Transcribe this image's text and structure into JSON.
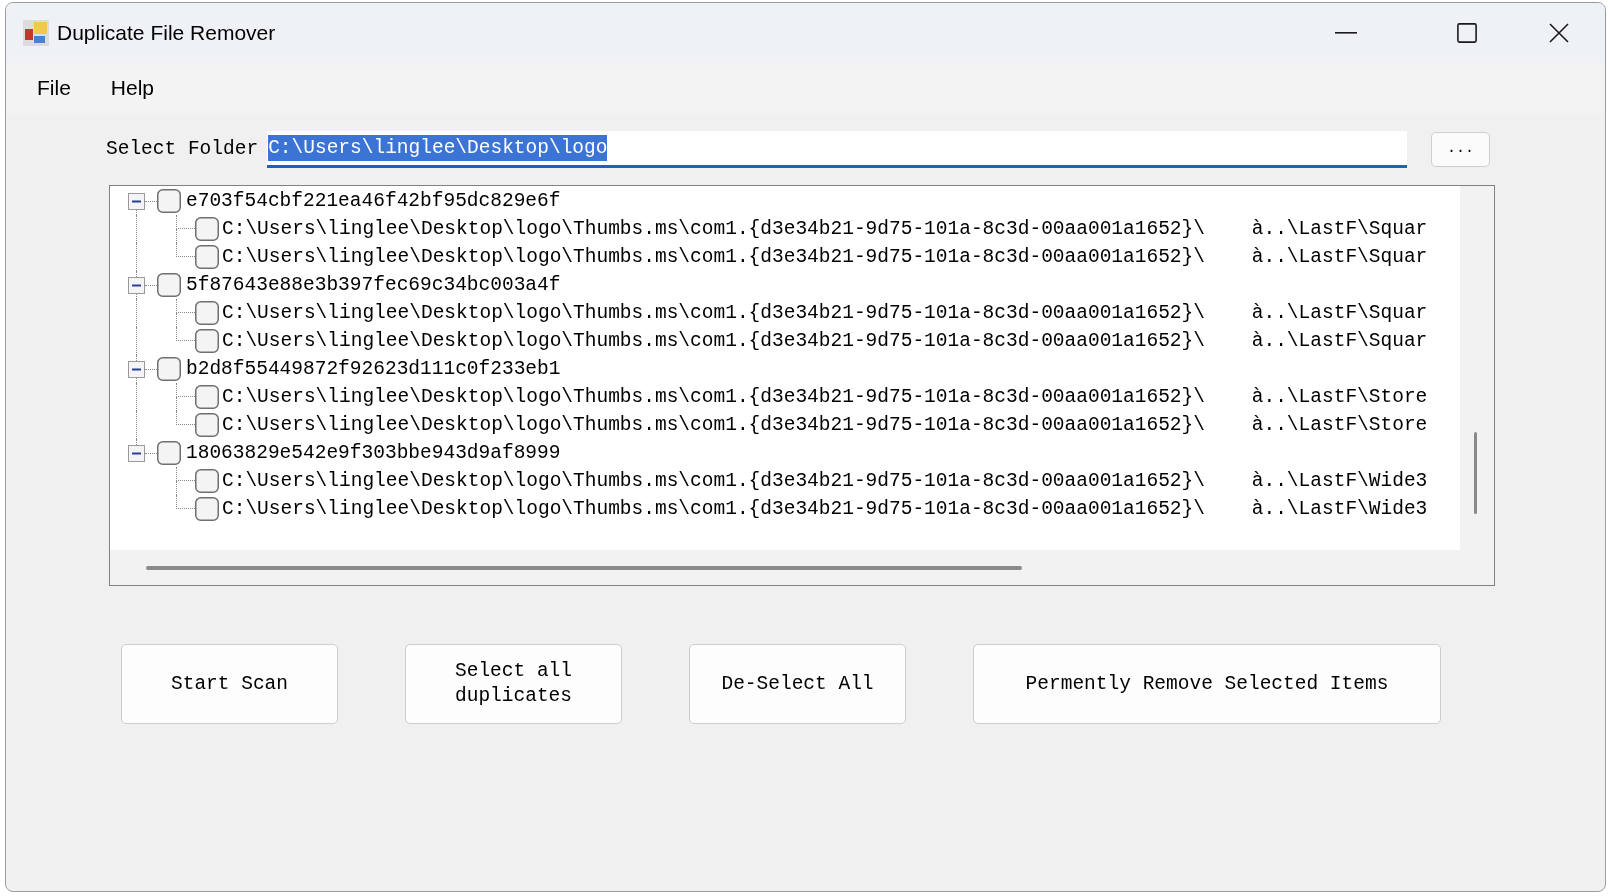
{
  "window": {
    "title": "Duplicate File Remover"
  },
  "menu": [
    {
      "label": "File"
    },
    {
      "label": "Help"
    }
  ],
  "folder": {
    "label": "Select Folder",
    "value": "C:\\Users\\linglee\\Desktop\\logo",
    "text_selected": true,
    "browse_button": "..."
  },
  "tree": {
    "nodes": [
      {
        "label": "e703f54cbf221ea46f42bf95dc829e6f",
        "checked": false,
        "expanded": true,
        "children": [
          {
            "label": "C:\\Users\\linglee\\Desktop\\logo\\Thumbs.ms\\com1.{d3e34b21-9d75-101a-8c3d-00aa001a1652}\\    à..\\LastF\\Squar",
            "checked": false
          },
          {
            "label": "C:\\Users\\linglee\\Desktop\\logo\\Thumbs.ms\\com1.{d3e34b21-9d75-101a-8c3d-00aa001a1652}\\    à..\\LastF\\Squar",
            "checked": false
          }
        ]
      },
      {
        "label": "5f87643e88e3b397fec69c34bc003a4f",
        "checked": false,
        "expanded": true,
        "children": [
          {
            "label": "C:\\Users\\linglee\\Desktop\\logo\\Thumbs.ms\\com1.{d3e34b21-9d75-101a-8c3d-00aa001a1652}\\    à..\\LastF\\Squar",
            "checked": false
          },
          {
            "label": "C:\\Users\\linglee\\Desktop\\logo\\Thumbs.ms\\com1.{d3e34b21-9d75-101a-8c3d-00aa001a1652}\\    à..\\LastF\\Squar",
            "checked": false
          }
        ]
      },
      {
        "label": "b2d8f55449872f92623d111c0f233eb1",
        "checked": false,
        "expanded": true,
        "children": [
          {
            "label": "C:\\Users\\linglee\\Desktop\\logo\\Thumbs.ms\\com1.{d3e34b21-9d75-101a-8c3d-00aa001a1652}\\    à..\\LastF\\Store",
            "checked": false
          },
          {
            "label": "C:\\Users\\linglee\\Desktop\\logo\\Thumbs.ms\\com1.{d3e34b21-9d75-101a-8c3d-00aa001a1652}\\    à..\\LastF\\Store",
            "checked": false
          }
        ]
      },
      {
        "label": "18063829e542e9f303bbe943d9af8999",
        "checked": false,
        "expanded": true,
        "children": [
          {
            "label": "C:\\Users\\linglee\\Desktop\\logo\\Thumbs.ms\\com1.{d3e34b21-9d75-101a-8c3d-00aa001a1652}\\    à..\\LastF\\Wide3",
            "checked": false
          },
          {
            "label": "C:\\Users\\linglee\\Desktop\\logo\\Thumbs.ms\\com1.{d3e34b21-9d75-101a-8c3d-00aa001a1652}\\    à..\\LastF\\Wide3",
            "checked": false
          }
        ]
      }
    ]
  },
  "buttons": [
    {
      "label": "Start Scan"
    },
    {
      "label": "Select all duplicates"
    },
    {
      "label": "De-Select All"
    },
    {
      "label": "Permently Remove Selected Items"
    }
  ]
}
